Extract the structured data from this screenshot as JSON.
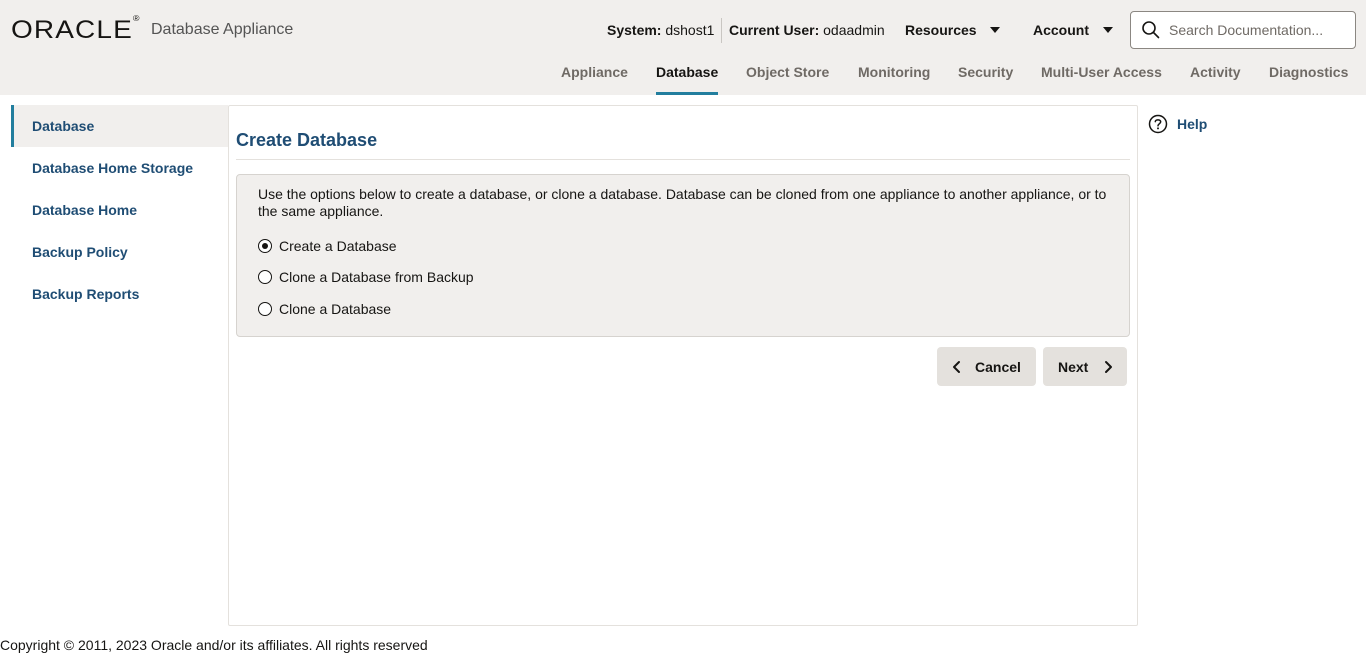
{
  "header": {
    "logo_text": "ORACLE",
    "logo_mark": "®",
    "app_name": "Database Appliance",
    "system_label": "System:",
    "system_value": "dshost1",
    "user_label": "Current User:",
    "user_value": "odaadmin",
    "resources_label": "Resources",
    "account_label": "Account",
    "search_placeholder": "Search Documentation..."
  },
  "nav": {
    "tabs": [
      {
        "label": "Appliance"
      },
      {
        "label": "Database"
      },
      {
        "label": "Object Store"
      },
      {
        "label": "Monitoring"
      },
      {
        "label": "Security"
      },
      {
        "label": "Multi-User Access"
      },
      {
        "label": "Activity"
      },
      {
        "label": "Diagnostics"
      }
    ],
    "active_tab": "Database"
  },
  "sidebar": {
    "items": [
      {
        "label": "Database"
      },
      {
        "label": "Database Home Storage"
      },
      {
        "label": "Database Home"
      },
      {
        "label": "Backup Policy"
      },
      {
        "label": "Backup Reports"
      }
    ],
    "active_item": "Database"
  },
  "main": {
    "title": "Create Database",
    "description": "Use the options below to create a database, or clone a database. Database can be cloned from one appliance to another appliance, or to the same appliance.",
    "options": [
      {
        "label": "Create a Database",
        "selected": true
      },
      {
        "label": "Clone a Database from Backup",
        "selected": false
      },
      {
        "label": "Clone a Database",
        "selected": false
      }
    ],
    "cancel_label": "Cancel",
    "next_label": "Next"
  },
  "help": {
    "label": "Help"
  },
  "footer": {
    "copyright": "Copyright © 2011, 2023 Oracle and/or its affiliates. All rights reserved"
  },
  "colors": {
    "header_bg": "#f1efed",
    "accent": "#227e9e",
    "link": "#1f4d74",
    "button_bg": "#e4e1dd"
  },
  "icons": [
    "search-icon",
    "caret-down-icon",
    "chevron-left-icon",
    "chevron-right-icon",
    "help-icon",
    "radio-icon"
  ]
}
